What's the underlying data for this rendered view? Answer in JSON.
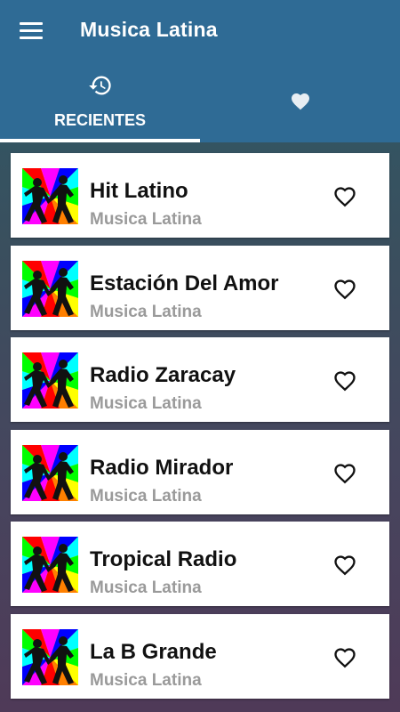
{
  "app": {
    "title": "Musica Latina"
  },
  "tabs": [
    {
      "label": "RECIENTES",
      "icon": "history-icon",
      "selected": true
    },
    {
      "label": "",
      "icon": "heart-icon",
      "selected": false
    }
  ],
  "stations": [
    {
      "name": "Hit Latino",
      "genre": "Musica Latina"
    },
    {
      "name": "Estación Del Amor",
      "genre": "Musica Latina"
    },
    {
      "name": "Radio Zaracay",
      "genre": "Musica Latina"
    },
    {
      "name": "Radio Mirador",
      "genre": "Musica Latina"
    },
    {
      "name": "Tropical Radio",
      "genre": "Musica Latina"
    },
    {
      "name": "La B Grande",
      "genre": "Musica Latina"
    }
  ],
  "colors": {
    "appbar": "#2f6b95",
    "card": "#ffffff",
    "subtitle": "#9a9a9a"
  }
}
